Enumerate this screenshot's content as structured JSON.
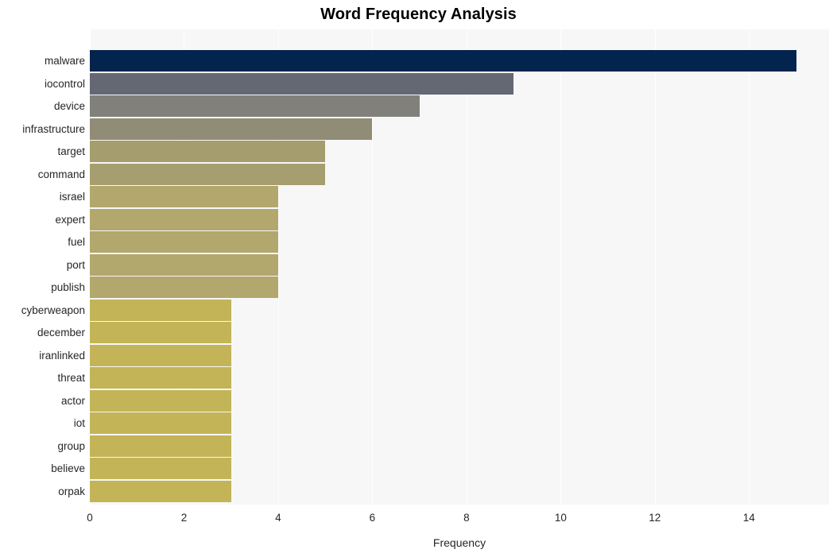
{
  "chart_data": {
    "type": "bar",
    "orientation": "horizontal",
    "title": "Word Frequency Analysis",
    "xlabel": "Frequency",
    "ylabel": "",
    "xlim": [
      0,
      15.7
    ],
    "ylim": null,
    "grid": true,
    "legend": false,
    "xticks": [
      0,
      2,
      4,
      6,
      8,
      10,
      12,
      14
    ],
    "xtick_labels": [
      "0",
      "2",
      "4",
      "6",
      "8",
      "10",
      "12",
      "14"
    ],
    "categories": [
      "malware",
      "iocontrol",
      "device",
      "infrastructure",
      "target",
      "command",
      "israel",
      "expert",
      "fuel",
      "port",
      "publish",
      "cyberweapon",
      "december",
      "iranlinked",
      "threat",
      "actor",
      "iot",
      "group",
      "believe",
      "orpak"
    ],
    "values": [
      15,
      9,
      7,
      6,
      5,
      5,
      4,
      4,
      4,
      4,
      4,
      3,
      3,
      3,
      3,
      3,
      3,
      3,
      3,
      3
    ],
    "bar_colors": [
      "#03244d",
      "#646873",
      "#82807b",
      "#918c76",
      "#a69d6f",
      "#a79e70",
      "#b2a76c",
      "#b2a76c",
      "#b2a76c",
      "#b2a76c",
      "#b2a76c",
      "#c3b457",
      "#c3b457",
      "#c3b457",
      "#c3b457",
      "#c3b457",
      "#c3b457",
      "#c3b457",
      "#c3b457",
      "#c3b457"
    ],
    "plot_background": "#f7f7f7",
    "figure_background": "#ffffff",
    "gridline_color": "#ffffff",
    "text_color": "#262626",
    "title_color": "#000000"
  }
}
